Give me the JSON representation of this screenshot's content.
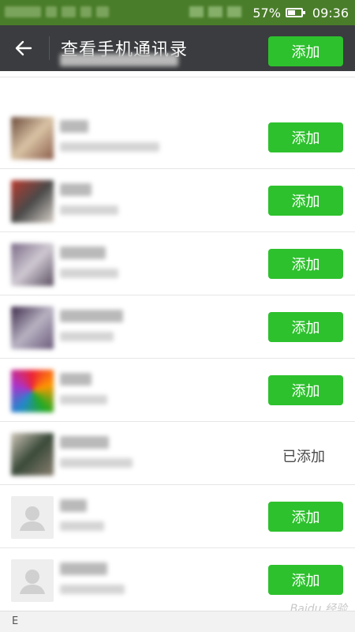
{
  "status_bar": {
    "battery_percent": "57%",
    "battery_level": 0.57,
    "time": "09:36"
  },
  "header": {
    "title": "查看手机通讯录"
  },
  "contacts": [
    {
      "button": "添加"
    },
    {
      "button": "添加"
    },
    {
      "button": "添加"
    },
    {
      "button": "添加"
    },
    {
      "button": "添加"
    },
    {
      "button": "添加"
    },
    {
      "status": "已添加"
    },
    {
      "button": "添加"
    },
    {
      "button": "添加"
    }
  ],
  "index_header": {
    "letter": "E"
  },
  "watermark": "Baidu 经验",
  "colors": {
    "status_bar": "#4a7d2a",
    "title_bar": "#3a3c3f",
    "add_button": "#2dc12d"
  }
}
